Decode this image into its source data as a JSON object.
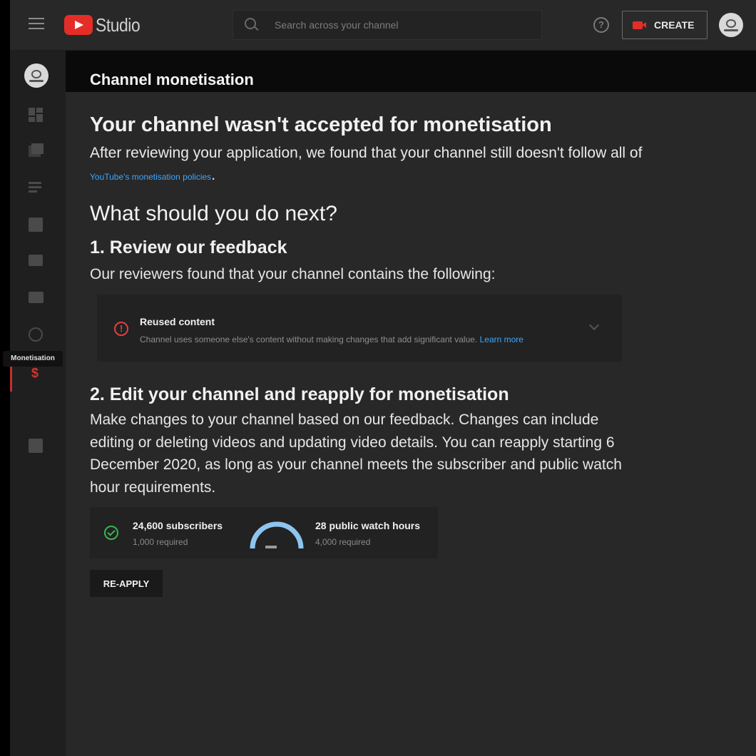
{
  "topbar": {
    "logo_text": "Studio",
    "search_placeholder": "Search across your channel",
    "create_label": "CREATE",
    "help_glyph": "?"
  },
  "sidebar": {
    "items": [
      {
        "name": "dashboard",
        "icon": "dashboard-icon"
      },
      {
        "name": "content",
        "icon": "video-library-icon"
      },
      {
        "name": "playlists",
        "icon": "playlist-icon"
      },
      {
        "name": "analytics",
        "icon": "analytics-icon"
      },
      {
        "name": "comments",
        "icon": "comment-icon"
      },
      {
        "name": "subtitles",
        "icon": "subtitles-icon"
      },
      {
        "name": "copyright",
        "icon": "copyright-icon"
      },
      {
        "name": "monetisation",
        "icon": "dollar-icon",
        "glyph": "$",
        "active": true
      },
      {
        "name": "audio-library",
        "icon": "audio-library-icon"
      }
    ],
    "tooltip": "Monetisation"
  },
  "main": {
    "page_title": "Channel monetisation",
    "rejected_heading": "Your channel wasn't accepted for monetisation",
    "rejected_body": "After reviewing your application, we found that your channel still doesn't follow all of",
    "policy_link": "YouTube's monetisation policies",
    "policy_after": ".",
    "next_heading": "What should you do next?",
    "step1_heading": "1. Review our feedback",
    "step1_body": "Our reviewers found that your channel contains the following:",
    "feedback": {
      "warning_glyph": "!",
      "title": "Reused content",
      "description": "Channel uses someone else's content without making changes that add significant value.",
      "learn_more": "Learn more"
    },
    "step2_heading": "2. Edit your channel and reapply for monetisation",
    "step2_body": "Make changes to your channel based on our feedback. Changes can include editing or deleting videos and updating video details. You can reapply starting 6 December 2020, as long as your channel meets the subscriber and public watch hour requirements.",
    "requirements": {
      "subscribers": "24,600 subscribers",
      "subscribers_required": "1,000 required",
      "subscribers_met": true,
      "watch_hours": "28 public watch hours",
      "watch_hours_required": "4,000 required",
      "watch_hours_progress": 0.007
    },
    "reapply_label": "RE-APPLY"
  },
  "colors": {
    "accent_red": "#e52d27",
    "link_blue": "#3ea6ff",
    "success_green": "#3db34d",
    "warning_red": "#e04040",
    "gauge_blue": "#8ec5ee"
  }
}
